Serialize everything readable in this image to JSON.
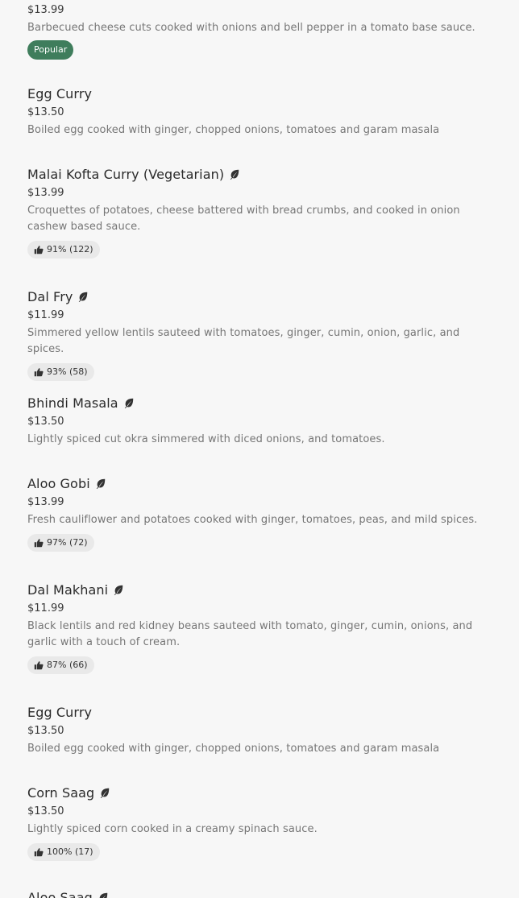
{
  "items": [
    {
      "name": "",
      "price": "$13.99",
      "description": "Barbecued cheese cuts cooked with onions and bell pepper in a tomato base sauce.",
      "badge": "Popular"
    },
    {
      "name": "Egg Curry",
      "price": "$13.50",
      "description": "Boiled egg cooked with ginger, chopped onions, tomatoes and garam masala"
    },
    {
      "name": "Malai Kofta Curry (Vegetarian)",
      "vegetarian": true,
      "price": "$13.99",
      "description": "Croquettes of potatoes, cheese battered with bread crumbs, and cooked in onion cashew based sauce.",
      "rating": "91% (122)"
    },
    {
      "name": "Dal Fry",
      "vegetarian": true,
      "price": "$11.99",
      "description": "Simmered yellow lentils sauteed with tomatoes, ginger, cumin, onion, garlic, and spices.",
      "rating": "93% (58)"
    },
    {
      "name": "Bhindi Masala",
      "vegetarian": true,
      "price": "$13.50",
      "description": "Lightly spiced cut okra simmered with diced onions, and tomatoes."
    },
    {
      "name": "Aloo Gobi",
      "vegetarian": true,
      "price": "$13.99",
      "description": "Fresh cauliflower and potatoes cooked with ginger, tomatoes, peas, and mild spices.",
      "rating": "97% (72)"
    },
    {
      "name": "Dal Makhani",
      "vegetarian": true,
      "price": "$11.99",
      "description": "Black lentils and red kidney beans sauteed with tomato, ginger, cumin, onions, and garlic with a touch of cream.",
      "rating": "87% (66)"
    },
    {
      "name": "Egg Curry",
      "price": "$13.50",
      "description": "Boiled egg cooked with ginger, chopped onions, tomatoes and garam masala"
    },
    {
      "name": "Corn Saag",
      "vegetarian": true,
      "price": "$13.50",
      "description": "Lightly spiced corn cooked in a creamy spinach sauce.",
      "rating": "100% (17)"
    },
    {
      "name": "Aloo Saag",
      "vegetarian": true
    }
  ],
  "icons": {
    "vegetarian": "leaf-icon",
    "rating": "thumbs-up-icon"
  },
  "colors": {
    "popular_badge": "#3f7d5c",
    "rating_pill": "#e9e9e9"
  }
}
